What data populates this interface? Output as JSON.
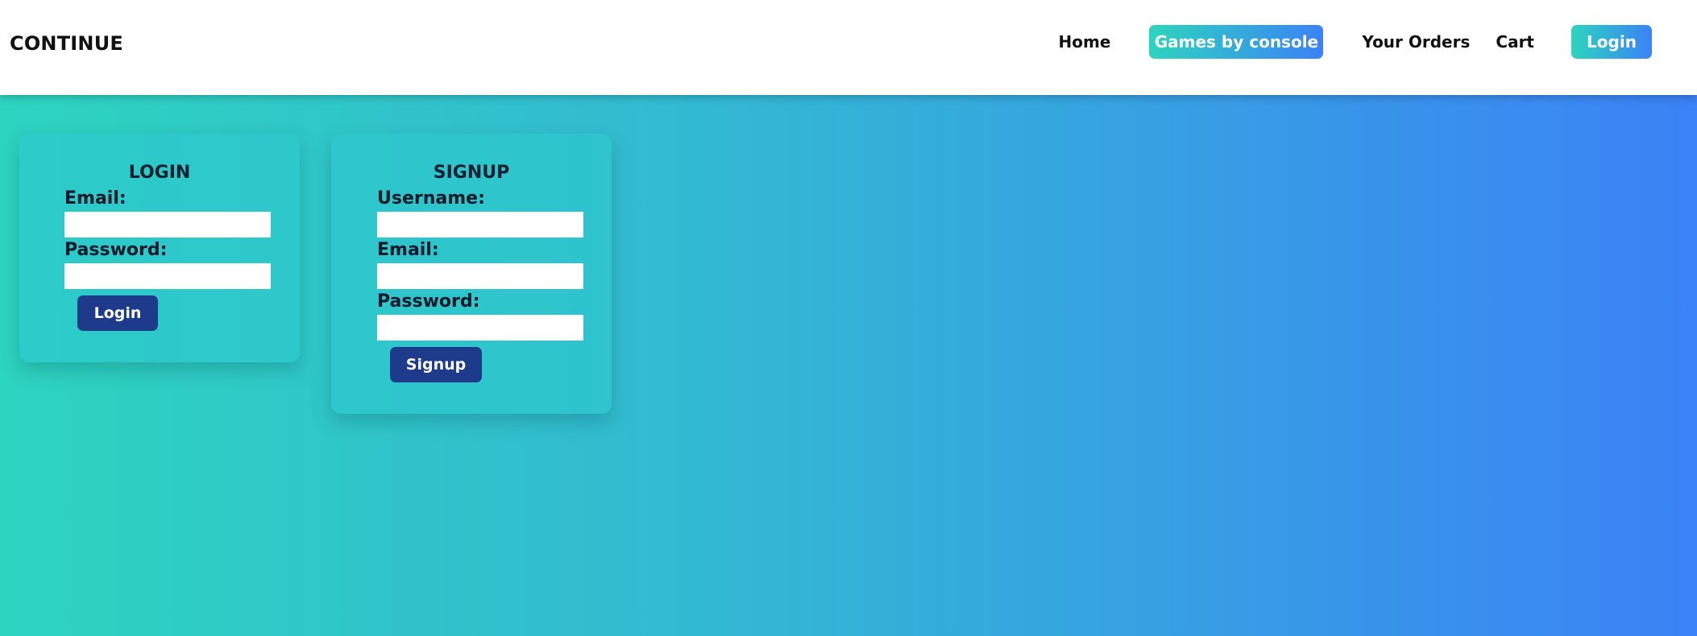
{
  "header": {
    "brand": "CONTINUE",
    "nav": {
      "home": "Home",
      "games_by_console": "Games by console",
      "your_orders": "Your Orders",
      "cart": "Cart",
      "login": "Login"
    }
  },
  "login_form": {
    "title": "LOGIN",
    "email_label": "Email:",
    "email_value": "",
    "password_label": "Password:",
    "password_value": "",
    "submit_label": "Login"
  },
  "signup_form": {
    "title": "SIGNUP",
    "username_label": "Username:",
    "username_value": "",
    "email_label": "Email:",
    "email_value": "",
    "password_label": "Password:",
    "password_value": "",
    "submit_label": "Signup"
  },
  "colors": {
    "gradient_start": "#2dd4bf",
    "gradient_end": "#3b82f6",
    "button_bg": "#1e3a8a"
  }
}
